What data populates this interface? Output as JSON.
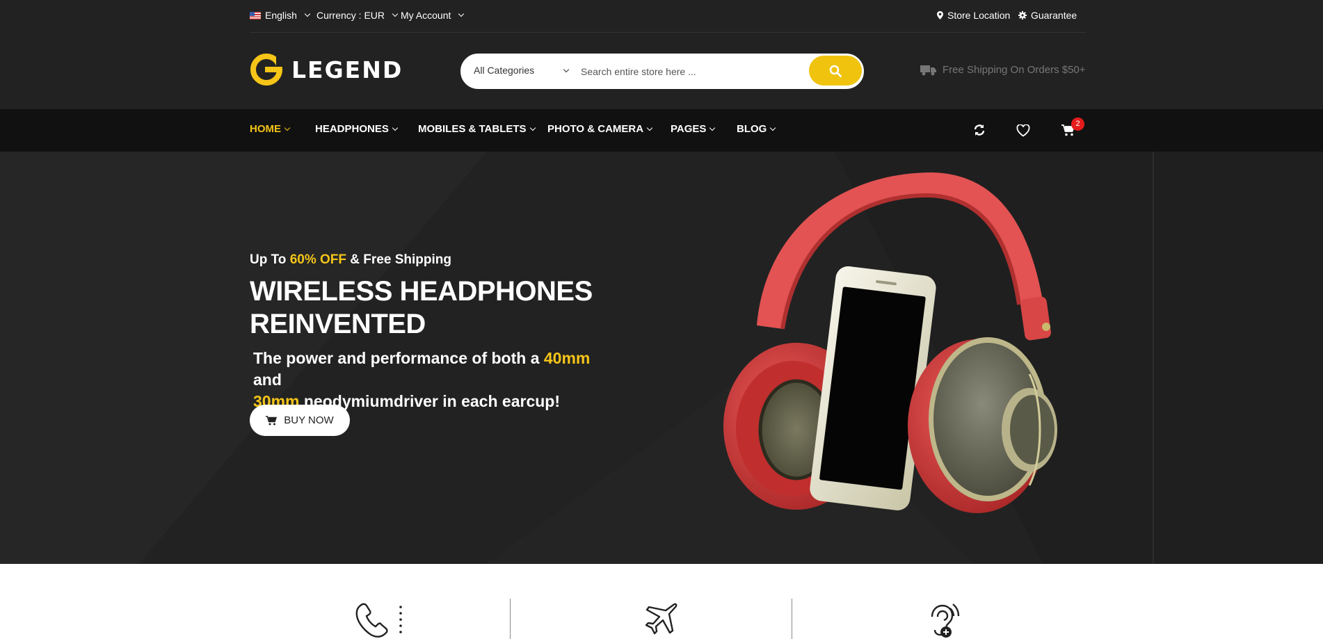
{
  "topbar": {
    "language": "English",
    "currency": "Currency : EUR",
    "account": "My Account",
    "store_location": "Store Location",
    "guarantee": "Guarantee"
  },
  "logo": {
    "text": "LEGEND"
  },
  "search": {
    "category": "All Categories",
    "placeholder": "Search entire store here ..."
  },
  "shipping": {
    "text": "Free Shipping On Orders $50+"
  },
  "nav": {
    "items": [
      {
        "label": "HOME"
      },
      {
        "label": "HEADPHONES"
      },
      {
        "label": "MOBILES & TABLETS"
      },
      {
        "label": "PHOTO & CAMERA"
      },
      {
        "label": "PAGES"
      },
      {
        "label": "BLOG"
      }
    ],
    "cart_count": "2"
  },
  "hero": {
    "sub_prefix": "Up To ",
    "sub_highlight": "60% OFF",
    "sub_suffix": " & Free Shipping",
    "title_line1": "WIRELESS HEADPHONES",
    "title_line2": "REINVENTED",
    "desc_1": "The power and performance of both a ",
    "desc_h1": "40mm",
    "desc_2": " and",
    "desc_h2": "30mm",
    "desc_3": " neodymiumdriver in each earcup!",
    "button": "BUY NOW"
  },
  "colors": {
    "accent": "#f5c518",
    "dark": "#222222",
    "nav_bg": "#111111",
    "badge": "#e51c1c"
  },
  "features": [
    {
      "icon": "phone-support-icon"
    },
    {
      "icon": "airplane-icon"
    },
    {
      "icon": "hearing-icon"
    }
  ]
}
